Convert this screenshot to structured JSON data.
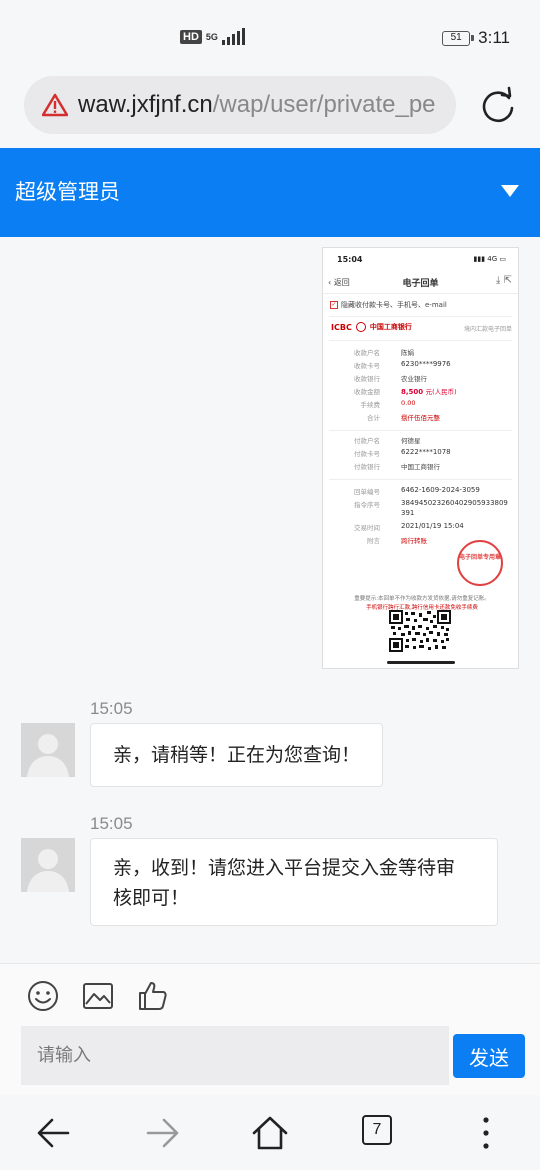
{
  "status_bar": {
    "hd": "HD",
    "network": "5G",
    "battery": "51",
    "time": "3:11"
  },
  "browser": {
    "url_host": "waw.jxfjnf.cn",
    "url_path": "/wap/user/private_pe",
    "tabs_count": "7"
  },
  "header": {
    "title": "超级管理员"
  },
  "receipt": {
    "time": "15:04",
    "back": "返回",
    "title": "电子回单",
    "privacy_option": "隐藏收付款卡号、手机号、e-mail",
    "bank_en": "ICBC",
    "bank_cn": "中国工商银行",
    "receipt_type": "境内汇款电子回单",
    "payee_rows": [
      {
        "k": "收款户名",
        "v": "陈娟"
      },
      {
        "k": "收款卡号",
        "v": "6230****9976"
      },
      {
        "k": "收款银行",
        "v": "农业银行"
      },
      {
        "k": "收款金额",
        "v": "8,500",
        "unit": "元(人民币)"
      },
      {
        "k": "手续费",
        "v": "0.00"
      },
      {
        "k": "合计",
        "v": "捌仟伍佰元整"
      }
    ],
    "payer_rows": [
      {
        "k": "付款户名",
        "v": "何德星"
      },
      {
        "k": "付款卡号",
        "v": "6222****1078"
      },
      {
        "k": "付款银行",
        "v": "中国工商银行"
      }
    ],
    "detail_rows": [
      {
        "k": "回单编号",
        "v": "6462-1609-2024-3059"
      },
      {
        "k": "指令序号",
        "v": "38494502326040290593380​9"
      },
      {
        "k": "",
        "v": "391"
      },
      {
        "k": "交易时间",
        "v": "2021/01/19 15:04"
      },
      {
        "k": "附言",
        "v": "跨行转账"
      }
    ],
    "stamp": "电子回单专用章",
    "note1": "重要提示:本回单不作为收款方发货依据,请勿重复记账。",
    "note2": "手机银行跨行汇款,跨行信用卡还款免收手续费"
  },
  "messages": [
    {
      "time": "15:05",
      "text": "亲，请稍等！正在为您查询！"
    },
    {
      "time": "15:05",
      "text_line1": "亲，收到！请您进入平台提交入金等待审",
      "text_line2": "核即可！"
    }
  ],
  "composer": {
    "placeholder": "请输入",
    "send": "发送"
  }
}
